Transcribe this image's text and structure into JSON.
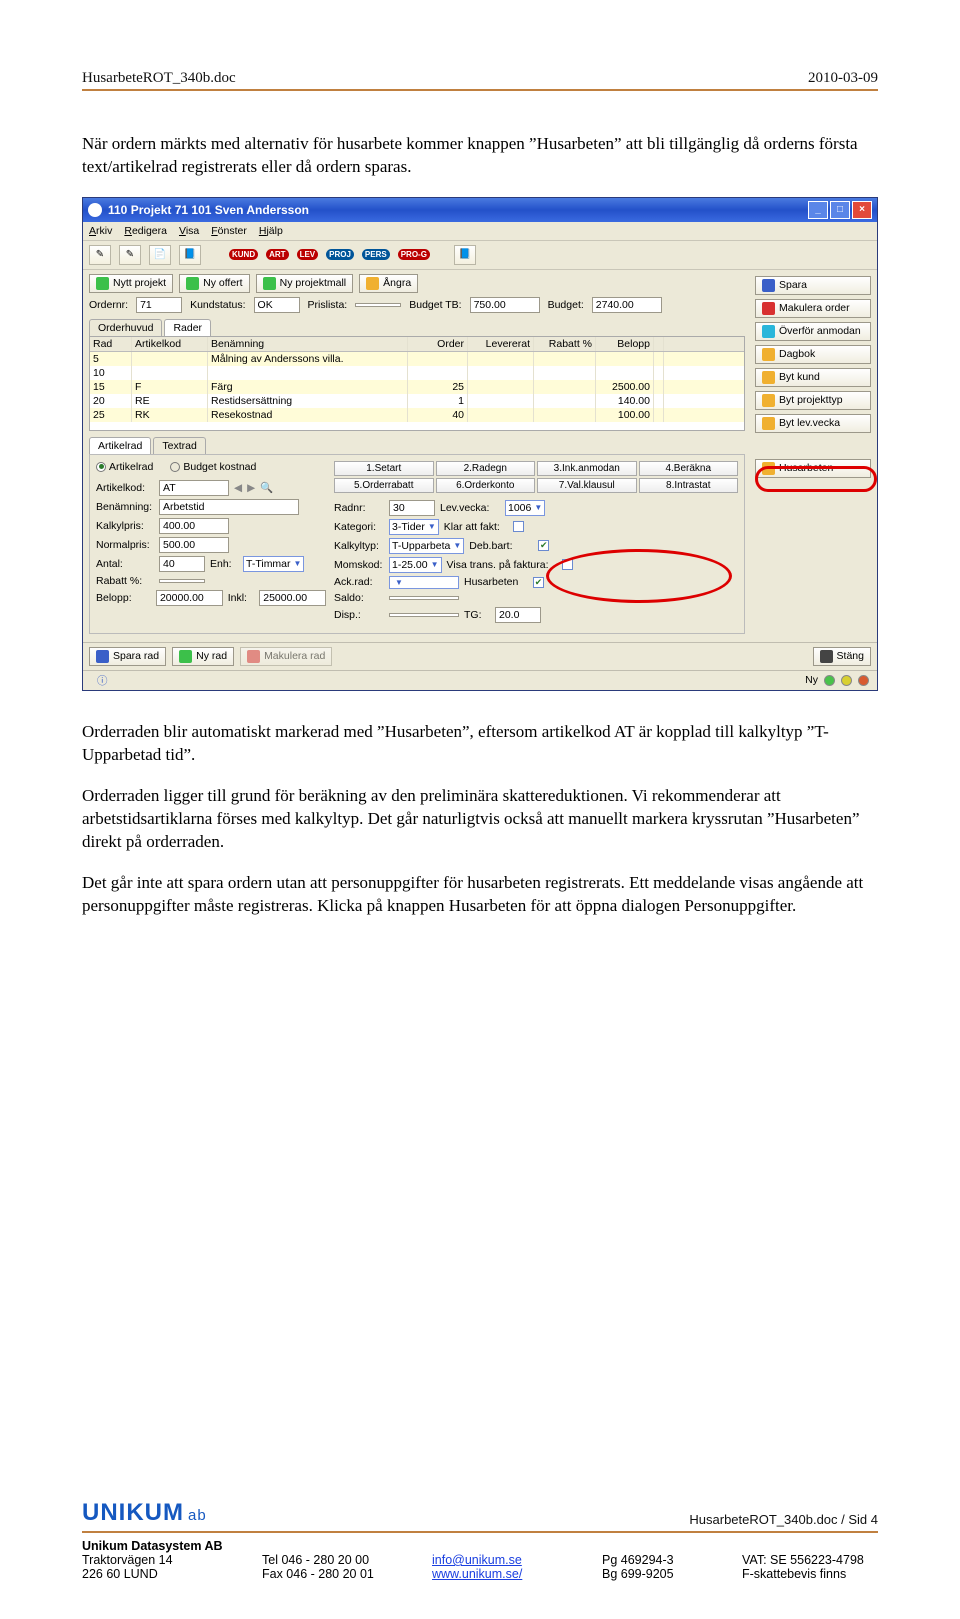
{
  "header": {
    "doc": "HusarbeteROT_340b.doc",
    "date": "2010-03-09"
  },
  "para1": "När ordern märkts med alternativ för husarbete kommer knappen ”Husarbeten” att bli tillgänglig då orderns första text/artikelrad registrerats eller då ordern sparas.",
  "window": {
    "title": "110 Projekt 71  101 Sven Andersson",
    "menu": [
      "Arkiv",
      "Redigera",
      "Visa",
      "Fönster",
      "Hjälp"
    ],
    "toolbar_pills": [
      "KUND",
      "ART",
      "LEV",
      "PROJ",
      "PERS",
      "PRO-G"
    ],
    "top_buttons": [
      "Nytt projekt",
      "Ny offert",
      "Ny projektmall",
      "Ångra"
    ],
    "orderline": {
      "ordernr_label": "Ordernr:",
      "ordernr": "71",
      "kundstatus_label": "Kundstatus:",
      "kundstatus": "OK",
      "prislista_label": "Prislista:",
      "budgettb_label": "Budget TB:",
      "budgettb": "750.00",
      "budget_label": "Budget:",
      "budget": "2740.00"
    },
    "tabs_upper": [
      "Orderhuvud",
      "Rader"
    ],
    "grid_headers": [
      "Rad",
      "Artikelkod",
      "Benämning",
      "Order",
      "Levererat",
      "Rabatt %",
      "Belopp"
    ],
    "grid_rows": [
      {
        "rad": "5",
        "art": "",
        "ben": "Målning av Anderssons villa.",
        "order": "",
        "lev": "",
        "rab": "",
        "bel": ""
      },
      {
        "rad": "10",
        "art": "",
        "ben": "",
        "order": "",
        "lev": "",
        "rab": "",
        "bel": ""
      },
      {
        "rad": "15",
        "art": "F",
        "ben": "Färg",
        "order": "25",
        "lev": "",
        "rab": "",
        "bel": "2500.00"
      },
      {
        "rad": "20",
        "art": "RE",
        "ben": "Restidsersättning",
        "order": "1",
        "lev": "",
        "rab": "",
        "bel": "140.00"
      },
      {
        "rad": "25",
        "art": "RK",
        "ben": "Resekostnad",
        "order": "40",
        "lev": "",
        "rab": "",
        "bel": "100.00"
      }
    ],
    "tabs_lower": [
      "Artikelrad",
      "Textrad"
    ],
    "panel": {
      "radio_artikelrad": "Artikelrad",
      "radio_budget": "Budget kostnad",
      "artikelkod_label": "Artikelkod:",
      "artikelkod": "AT",
      "benamning_label": "Benämning:",
      "benamning": "Arbetstid",
      "kalkylpris_label": "Kalkylpris:",
      "kalkylpris": "400.00",
      "normalpris_label": "Normalpris:",
      "normalpris": "500.00",
      "antal_label": "Antal:",
      "antal": "40",
      "enh_label": "Enh:",
      "enh": "T-Timmar",
      "rabatt_label": "Rabatt %:",
      "belopp_label": "Belopp:",
      "belopp": "20000.00",
      "inkl_label": "Inkl:",
      "inkl": "25000.00",
      "btns8": [
        "1.Setart",
        "2.Radegn",
        "3.Ink.anmodan",
        "4.Beräkna",
        "5.Orderrabatt",
        "6.Orderkonto",
        "7.Val.klausul",
        "8.Intrastat"
      ],
      "radnr_label": "Radnr:",
      "radnr": "30",
      "levvecka_label": "Lev.vecka:",
      "levvecka": "1006",
      "kategori_label": "Kategori:",
      "kategori": "3-Tider",
      "kalkyltyp_label": "Kalkyltyp:",
      "kalkyltyp": "T-Upparbeta",
      "momskod_label": "Momskod:",
      "momskod": "1-25.00",
      "ackrad_label": "Ack.rad:",
      "saldo_label": "Saldo:",
      "disp_label": "Disp.:",
      "klar_label": "Klar att fakt:",
      "debbart_label": "Deb.bart:",
      "visatrans_label": "Visa trans. på faktura:",
      "husarbeten_label": "Husarbeten",
      "tg_label": "TG:",
      "tg": "20.0"
    },
    "side_buttons": [
      "Spara",
      "Makulera order",
      "Överför anmodan",
      "Dagbok",
      "Byt kund",
      "Byt projekttyp",
      "Byt lev.vecka",
      "Husarbeten"
    ],
    "bottom_left": [
      "Spara rad",
      "Ny rad",
      "Makulera rad"
    ],
    "bottom_right": "Stäng",
    "status_ny": "Ny"
  },
  "para2": "Orderraden blir automatiskt markerad med ”Husarbeten”, eftersom artikelkod AT är kopplad till kalkyltyp ”T-Upparbetad tid”.",
  "para3": "Orderraden ligger till grund för beräkning av den preliminära skattereduktionen. Vi rekommenderar att arbetstidsartiklarna förses med kalkyltyp. Det går naturligtvis också att manuellt markera kryssrutan ”Husarbeten” direkt på orderraden.",
  "para4": "Det går inte att spara ordern utan att personuppgifter för husarbeten registrerats. Ett meddelande visas angående att personuppgifter måste registreras. Klicka på knappen Husarbeten för att öppna dialogen Personuppgifter.",
  "footer": {
    "logo": "UNIKUM",
    "logo_ab": "ab",
    "page": "HusarbeteROT_340b.doc / Sid 4",
    "company": "Unikum Datasystem AB",
    "addr1": "Traktorvägen 14",
    "addr2": "226 60  LUND",
    "tel": "Tel  046 - 280 20 00",
    "fax": "Fax  046 - 280 20 01",
    "email": "info@unikum.se",
    "web": "www.unikum.se/",
    "pg": "Pg  469294-3",
    "bg": "Bg  699-9205",
    "vat": "VAT: SE 556223-4798",
    "fskatt": "F-skattebevis finns"
  }
}
